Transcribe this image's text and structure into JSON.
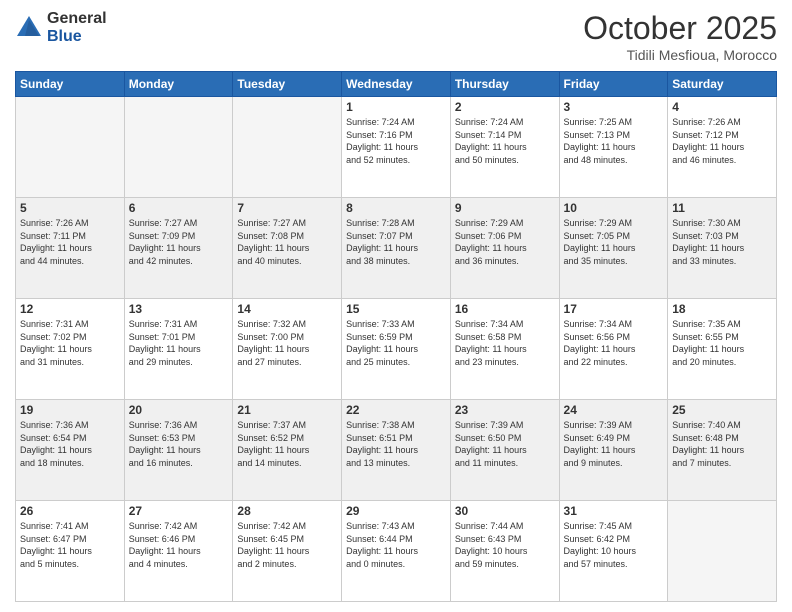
{
  "header": {
    "logo_general": "General",
    "logo_blue": "Blue",
    "month_title": "October 2025",
    "location": "Tidili Mesfioua, Morocco"
  },
  "days_of_week": [
    "Sunday",
    "Monday",
    "Tuesday",
    "Wednesday",
    "Thursday",
    "Friday",
    "Saturday"
  ],
  "weeks": [
    [
      {
        "num": "",
        "info": ""
      },
      {
        "num": "",
        "info": ""
      },
      {
        "num": "",
        "info": ""
      },
      {
        "num": "1",
        "info": "Sunrise: 7:24 AM\nSunset: 7:16 PM\nDaylight: 11 hours\nand 52 minutes."
      },
      {
        "num": "2",
        "info": "Sunrise: 7:24 AM\nSunset: 7:14 PM\nDaylight: 11 hours\nand 50 minutes."
      },
      {
        "num": "3",
        "info": "Sunrise: 7:25 AM\nSunset: 7:13 PM\nDaylight: 11 hours\nand 48 minutes."
      },
      {
        "num": "4",
        "info": "Sunrise: 7:26 AM\nSunset: 7:12 PM\nDaylight: 11 hours\nand 46 minutes."
      }
    ],
    [
      {
        "num": "5",
        "info": "Sunrise: 7:26 AM\nSunset: 7:11 PM\nDaylight: 11 hours\nand 44 minutes."
      },
      {
        "num": "6",
        "info": "Sunrise: 7:27 AM\nSunset: 7:09 PM\nDaylight: 11 hours\nand 42 minutes."
      },
      {
        "num": "7",
        "info": "Sunrise: 7:27 AM\nSunset: 7:08 PM\nDaylight: 11 hours\nand 40 minutes."
      },
      {
        "num": "8",
        "info": "Sunrise: 7:28 AM\nSunset: 7:07 PM\nDaylight: 11 hours\nand 38 minutes."
      },
      {
        "num": "9",
        "info": "Sunrise: 7:29 AM\nSunset: 7:06 PM\nDaylight: 11 hours\nand 36 minutes."
      },
      {
        "num": "10",
        "info": "Sunrise: 7:29 AM\nSunset: 7:05 PM\nDaylight: 11 hours\nand 35 minutes."
      },
      {
        "num": "11",
        "info": "Sunrise: 7:30 AM\nSunset: 7:03 PM\nDaylight: 11 hours\nand 33 minutes."
      }
    ],
    [
      {
        "num": "12",
        "info": "Sunrise: 7:31 AM\nSunset: 7:02 PM\nDaylight: 11 hours\nand 31 minutes."
      },
      {
        "num": "13",
        "info": "Sunrise: 7:31 AM\nSunset: 7:01 PM\nDaylight: 11 hours\nand 29 minutes."
      },
      {
        "num": "14",
        "info": "Sunrise: 7:32 AM\nSunset: 7:00 PM\nDaylight: 11 hours\nand 27 minutes."
      },
      {
        "num": "15",
        "info": "Sunrise: 7:33 AM\nSunset: 6:59 PM\nDaylight: 11 hours\nand 25 minutes."
      },
      {
        "num": "16",
        "info": "Sunrise: 7:34 AM\nSunset: 6:58 PM\nDaylight: 11 hours\nand 23 minutes."
      },
      {
        "num": "17",
        "info": "Sunrise: 7:34 AM\nSunset: 6:56 PM\nDaylight: 11 hours\nand 22 minutes."
      },
      {
        "num": "18",
        "info": "Sunrise: 7:35 AM\nSunset: 6:55 PM\nDaylight: 11 hours\nand 20 minutes."
      }
    ],
    [
      {
        "num": "19",
        "info": "Sunrise: 7:36 AM\nSunset: 6:54 PM\nDaylight: 11 hours\nand 18 minutes."
      },
      {
        "num": "20",
        "info": "Sunrise: 7:36 AM\nSunset: 6:53 PM\nDaylight: 11 hours\nand 16 minutes."
      },
      {
        "num": "21",
        "info": "Sunrise: 7:37 AM\nSunset: 6:52 PM\nDaylight: 11 hours\nand 14 minutes."
      },
      {
        "num": "22",
        "info": "Sunrise: 7:38 AM\nSunset: 6:51 PM\nDaylight: 11 hours\nand 13 minutes."
      },
      {
        "num": "23",
        "info": "Sunrise: 7:39 AM\nSunset: 6:50 PM\nDaylight: 11 hours\nand 11 minutes."
      },
      {
        "num": "24",
        "info": "Sunrise: 7:39 AM\nSunset: 6:49 PM\nDaylight: 11 hours\nand 9 minutes."
      },
      {
        "num": "25",
        "info": "Sunrise: 7:40 AM\nSunset: 6:48 PM\nDaylight: 11 hours\nand 7 minutes."
      }
    ],
    [
      {
        "num": "26",
        "info": "Sunrise: 7:41 AM\nSunset: 6:47 PM\nDaylight: 11 hours\nand 5 minutes."
      },
      {
        "num": "27",
        "info": "Sunrise: 7:42 AM\nSunset: 6:46 PM\nDaylight: 11 hours\nand 4 minutes."
      },
      {
        "num": "28",
        "info": "Sunrise: 7:42 AM\nSunset: 6:45 PM\nDaylight: 11 hours\nand 2 minutes."
      },
      {
        "num": "29",
        "info": "Sunrise: 7:43 AM\nSunset: 6:44 PM\nDaylight: 11 hours\nand 0 minutes."
      },
      {
        "num": "30",
        "info": "Sunrise: 7:44 AM\nSunset: 6:43 PM\nDaylight: 10 hours\nand 59 minutes."
      },
      {
        "num": "31",
        "info": "Sunrise: 7:45 AM\nSunset: 6:42 PM\nDaylight: 10 hours\nand 57 minutes."
      },
      {
        "num": "",
        "info": ""
      }
    ]
  ]
}
